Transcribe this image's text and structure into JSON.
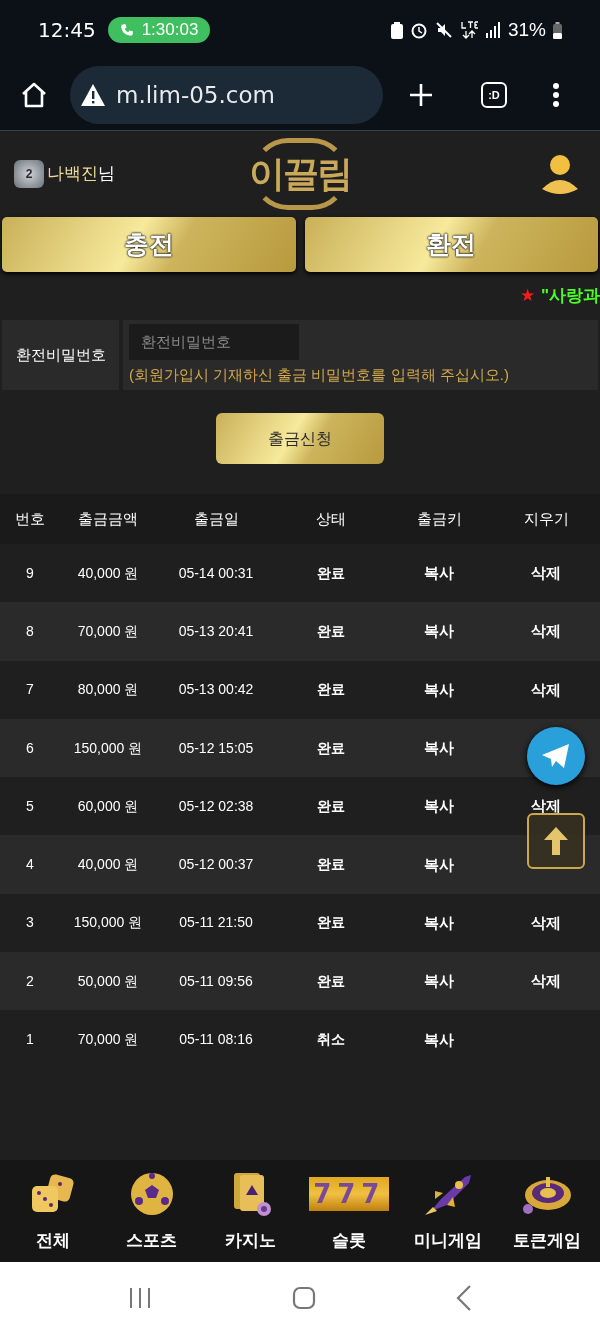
{
  "status_bar": {
    "time": "12:45",
    "call_timer": "1:30:03",
    "battery": "31%"
  },
  "browser": {
    "url": "m.lim-05.com",
    "tabs_label": ":D"
  },
  "header": {
    "username": "나백진",
    "suffix": "님",
    "level_badge": "2",
    "logo": "이끌림"
  },
  "main_buttons": [
    "충전",
    "환전"
  ],
  "marquee": {
    "star": "★",
    "text": "\"사랑과"
  },
  "form": {
    "label": "환전비밀번호",
    "placeholder": "환전비밀번호",
    "hint": "(회원가입시 기재하신 출금 비밀번호를 입력해 주십시오.)",
    "submit": "출금신청"
  },
  "table": {
    "columns": [
      "번호",
      "출금금액",
      "출금일",
      "상태",
      "출금키",
      "지우기"
    ],
    "rows": [
      {
        "no": "9",
        "amount": "40,000 원",
        "date": "05-14 00:31",
        "status": "완료",
        "key": "복사",
        "delete": "삭제"
      },
      {
        "no": "8",
        "amount": "70,000 원",
        "date": "05-13 20:41",
        "status": "완료",
        "key": "복사",
        "delete": "삭제"
      },
      {
        "no": "7",
        "amount": "80,000 원",
        "date": "05-13 00:42",
        "status": "완료",
        "key": "복사",
        "delete": "삭제"
      },
      {
        "no": "6",
        "amount": "150,000 원",
        "date": "05-12 15:05",
        "status": "완료",
        "key": "복사"
      },
      {
        "no": "5",
        "amount": "60,000 원",
        "date": "05-12 02:38",
        "status": "완료",
        "key": "복사",
        "delete": "삭제"
      },
      {
        "no": "4",
        "amount": "40,000 원",
        "date": "05-12 00:37",
        "status": "완료",
        "key": "복사"
      },
      {
        "no": "3",
        "amount": "150,000 원",
        "date": "05-11 21:50",
        "status": "완료",
        "key": "복사",
        "delete": "삭제"
      },
      {
        "no": "2",
        "amount": "50,000 원",
        "date": "05-11 09:56",
        "status": "완료",
        "key": "복사",
        "delete": "삭제"
      },
      {
        "no": "1",
        "amount": "70,000 원",
        "date": "05-11 08:16",
        "status": "취소",
        "key": "복사"
      }
    ]
  },
  "bottom_nav": [
    {
      "kind": "dice",
      "label": "전체"
    },
    {
      "kind": "ball",
      "label": "스포츠"
    },
    {
      "kind": "cards",
      "label": "카지노"
    },
    {
      "kind": "slot",
      "label": "슬롯",
      "icon_text": "777"
    },
    {
      "kind": "rocket",
      "label": "미니게임"
    },
    {
      "kind": "roulette",
      "label": "토큰게임"
    }
  ]
}
